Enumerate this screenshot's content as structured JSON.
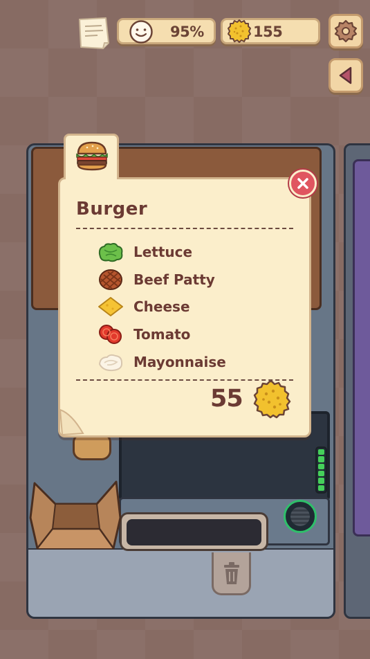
{
  "hud": {
    "satisfaction": "95%",
    "coins": "155"
  },
  "recipe": {
    "title": "Burger",
    "ingredients": [
      {
        "label": "Lettuce",
        "icon": "lettuce-icon"
      },
      {
        "label": "Beef Patty",
        "icon": "beef-patty-icon"
      },
      {
        "label": "Cheese",
        "icon": "cheese-icon"
      },
      {
        "label": "Tomato",
        "icon": "tomato-icon"
      },
      {
        "label": "Mayonnaise",
        "icon": "mayonnaise-icon"
      }
    ],
    "price": "55"
  },
  "colors": {
    "card": "#fbeecb",
    "text": "#6b3a33",
    "coin": "#f2c12e",
    "close": "#e05560",
    "heat": "#45d05a"
  }
}
